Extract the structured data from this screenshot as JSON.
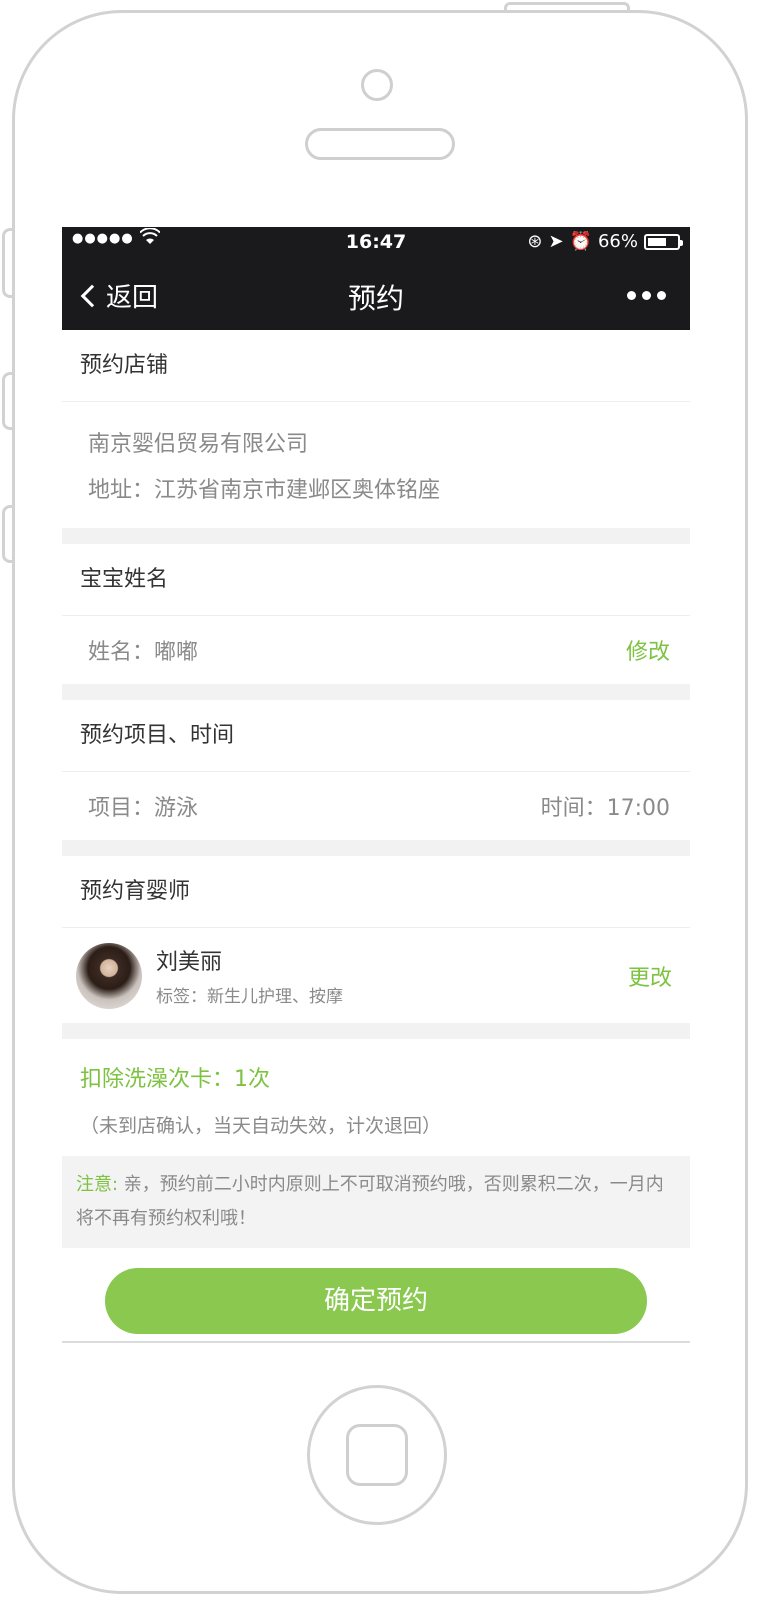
{
  "status": {
    "dots": "●●●●●",
    "time": "16:47",
    "battery": "66%",
    "battery_level": 0.66
  },
  "nav": {
    "back_label": "返回",
    "title": "预约"
  },
  "store_section": {
    "title": "预约店铺",
    "name": "南京婴侣贸易有限公司",
    "address": "地址：江苏省南京市建邺区奥体铭座"
  },
  "baby_section": {
    "title": "宝宝姓名",
    "name": "姓名：嘟嘟",
    "edit": "修改"
  },
  "project_section": {
    "title": "预约项目、时间",
    "project": "项目：游泳",
    "time": "时间：17:00"
  },
  "sitter_section": {
    "title": "预约育婴师",
    "name": "刘美丽",
    "tags": "标签：新生儿护理、按摩",
    "change": "更改"
  },
  "deduct": {
    "title": "扣除洗澡次卡：1次",
    "note": "（未到店确认，当天自动失效，计次退回）"
  },
  "notice": {
    "label": "注意:",
    "text": " 亲，预约前二小时内原则上不可取消预约哦，否则累积二次，一月内将不再有预约权利哦！"
  },
  "confirm_label": "确定预约",
  "colors": {
    "accent": "#7dc241",
    "button": "#8ac850",
    "navbar": "#1a1a1c"
  }
}
